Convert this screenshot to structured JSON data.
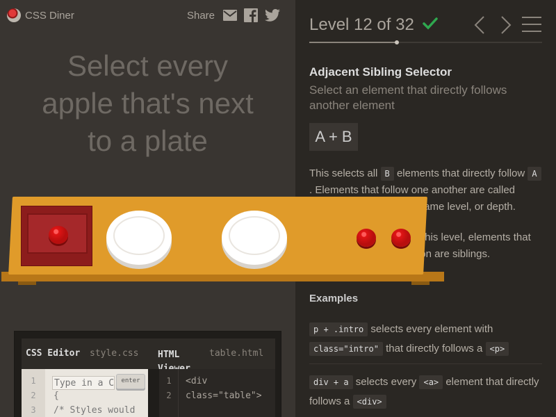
{
  "header": {
    "app_name": "CSS Diner",
    "share_label": "Share",
    "share_icons": [
      "email-icon",
      "facebook-icon",
      "twitter-icon"
    ]
  },
  "instruction": {
    "line1": "Select every",
    "line2": "apple that's next",
    "line3": "to a plate"
  },
  "editor": {
    "css_label": "CSS Editor",
    "css_file": "style.css",
    "html_label": "HTML Viewer",
    "html_file": "table.html",
    "css_input_placeholder": "Type in a CSS selector",
    "enter_label": "enter",
    "css_lines": [
      "1",
      "2",
      "3"
    ],
    "css_code": [
      "{",
      "/* Styles would"
    ],
    "html_lines": [
      "1",
      "2"
    ],
    "html_code": [
      "<div",
      "class=\"table\">"
    ]
  },
  "sidebar": {
    "level_text": "Level 12 of 32",
    "level_completed": true,
    "progress_fraction": 0.375,
    "selector_name": "Adjacent Sibling Selector",
    "title": "Select an element that directly follows another element",
    "syntax": "A + B",
    "hint_part1": "This selects all",
    "hint_tag_b": "B",
    "hint_part2": "elements that directly follow",
    "hint_tag_a": "A",
    "hint_part3": ". Elements that follow one another are called siblings. They're on the same level, or depth.",
    "hint2": "In the HTML markup for this level, elements that have the same indentation are siblings.",
    "examples_title": "Examples",
    "example1_code": "p + .intro",
    "example1_text_a": "selects every element with",
    "example1_code2": "class=\"intro\"",
    "example1_text_b": "that directly follows a",
    "example1_code3": "<p>",
    "example2_code": "div + a",
    "example2_text_a": "selects every",
    "example2_code2": "<a>",
    "example2_text_b": "element that directly follows a",
    "example2_code3": "<div>"
  },
  "colors": {
    "accent_check": "#2fa84f",
    "table": "#e09b2a",
    "apple": "#e01515",
    "bento": "#8c1c1c"
  }
}
